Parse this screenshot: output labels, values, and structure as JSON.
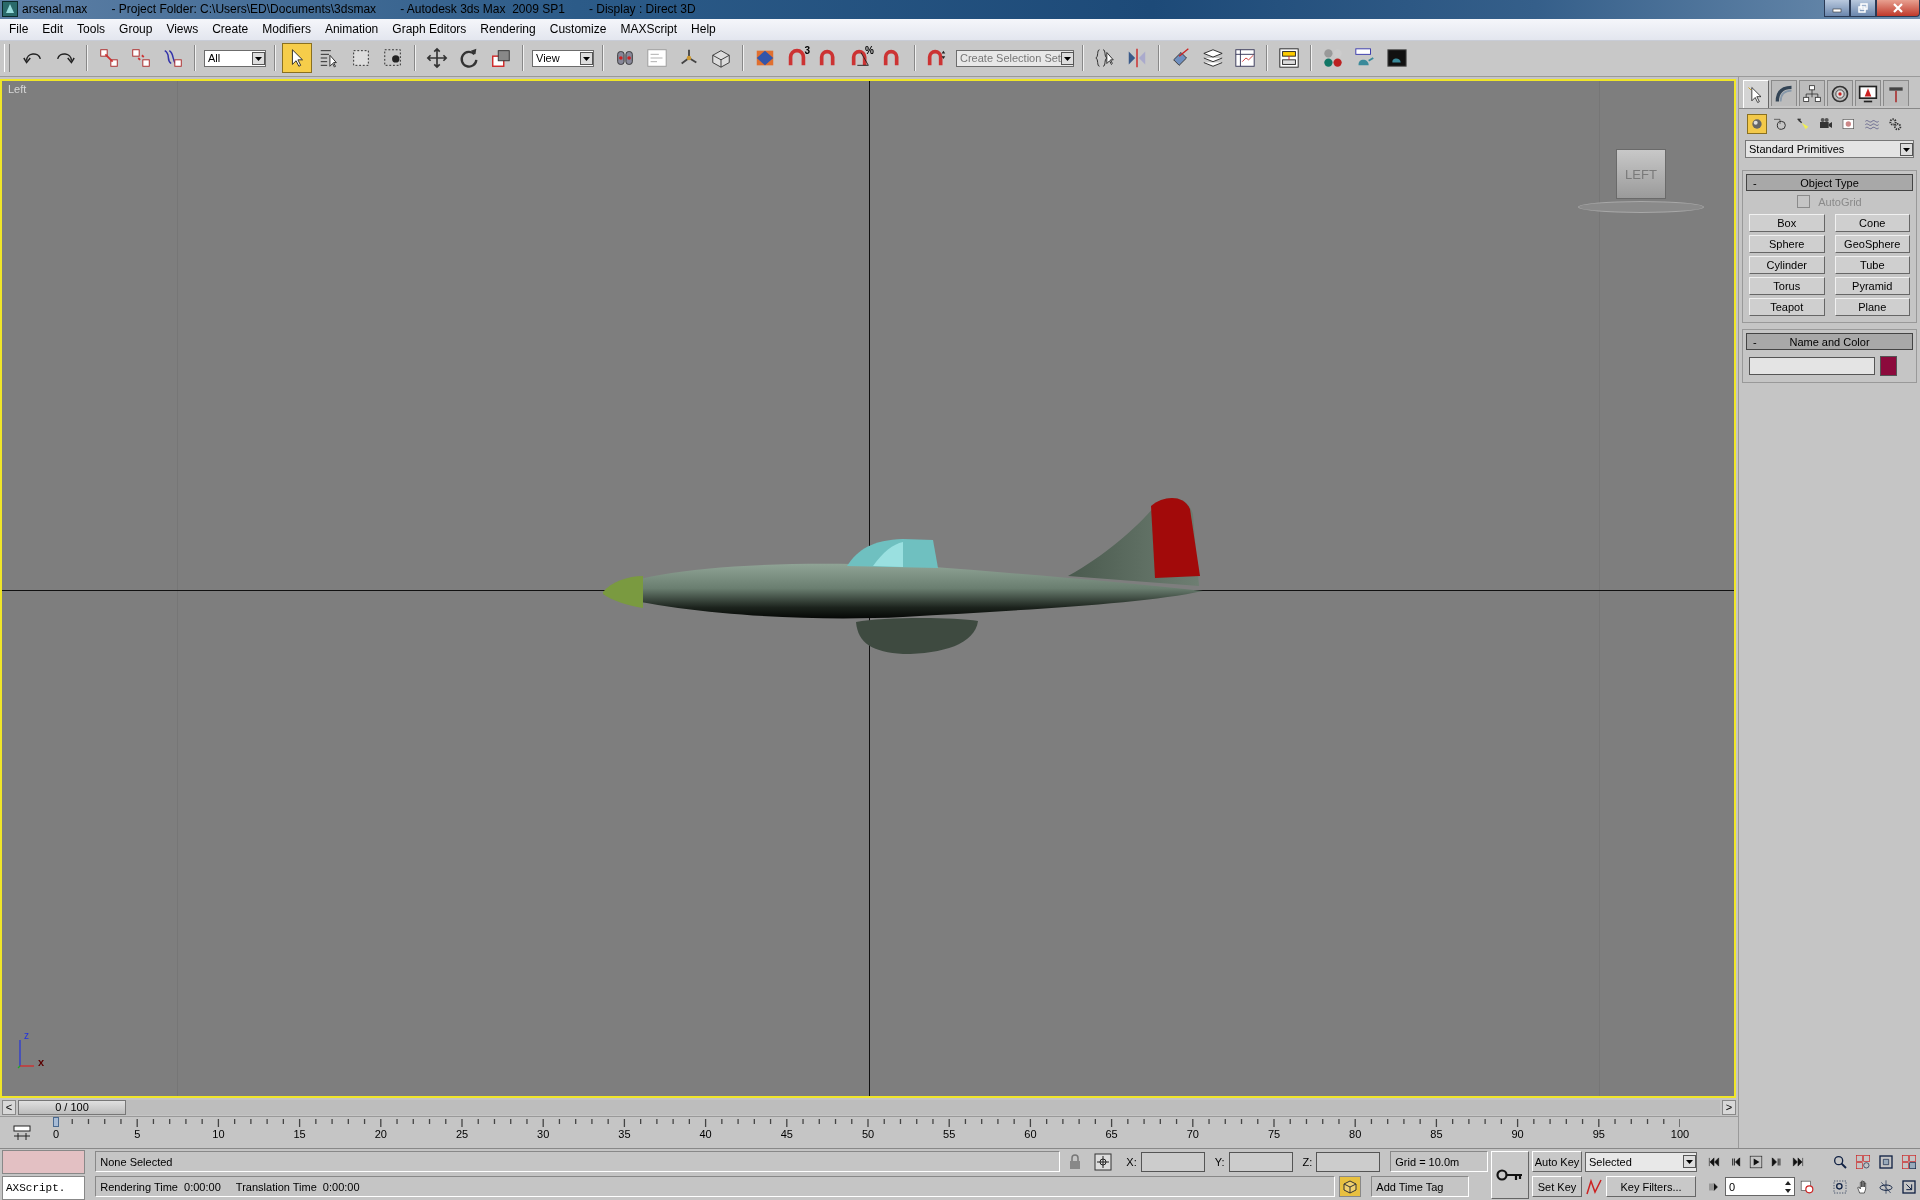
{
  "window": {
    "title_parts": [
      "arsenal.max",
      "- Project Folder: C:\\Users\\ED\\Documents\\3dsmax",
      "- Autodesk 3ds Max  2009 SP1",
      "- Display : Direct 3D"
    ]
  },
  "menu": [
    "File",
    "Edit",
    "Tools",
    "Group",
    "Views",
    "Create",
    "Modifiers",
    "Animation",
    "Graph Editors",
    "Rendering",
    "Customize",
    "MAXScript",
    "Help"
  ],
  "toolbar": {
    "items": [
      {
        "kind": "button",
        "selected": false
      },
      {
        "kind": "button",
        "selected": false
      },
      {
        "kind": "button",
        "selected": false
      },
      {
        "kind": "button",
        "selected": false
      },
      {
        "kind": "button",
        "selected": false
      },
      {
        "kind": "dropdown",
        "value": "All"
      },
      {
        "kind": "button",
        "selected": true
      },
      {
        "kind": "button",
        "selected": false
      },
      {
        "kind": "button",
        "selected": false
      },
      {
        "kind": "button",
        "selected": false
      },
      {
        "kind": "button",
        "selected": false
      },
      {
        "kind": "button",
        "selected": false
      },
      {
        "kind": "button",
        "selected": false
      },
      {
        "kind": "dropdown",
        "value": "View"
      },
      {
        "kind": "button",
        "selected": false
      },
      {
        "kind": "button",
        "selected": false
      },
      {
        "kind": "button",
        "selected": false
      },
      {
        "kind": "button",
        "selected": false
      },
      {
        "kind": "button",
        "selected": false
      },
      {
        "kind": "button",
        "selected": false,
        "badge": "3"
      },
      {
        "kind": "button",
        "selected": false
      },
      {
        "kind": "button",
        "selected": false,
        "badge": "%"
      },
      {
        "kind": "button",
        "selected": false
      },
      {
        "kind": "button",
        "selected": false
      },
      {
        "kind": "dropdown",
        "placeholder": "Create Selection Set"
      },
      {
        "kind": "button",
        "selected": false
      },
      {
        "kind": "button",
        "selected": false
      },
      {
        "kind": "button",
        "selected": false
      },
      {
        "kind": "button",
        "selected": false
      },
      {
        "kind": "button",
        "selected": false
      },
      {
        "kind": "button",
        "selected": false
      },
      {
        "kind": "button",
        "selected": false
      },
      {
        "kind": "button",
        "selected": false
      },
      {
        "kind": "button",
        "selected": false
      }
    ]
  },
  "viewport": {
    "label": "Left",
    "viewcube_label": "LEFT",
    "axis_labels": [
      "z",
      "x"
    ]
  },
  "command_panel": {
    "tabs": [
      {
        "selected": true
      },
      {
        "selected": false
      },
      {
        "selected": false
      },
      {
        "selected": false
      },
      {
        "selected": false
      },
      {
        "selected": false
      }
    ],
    "categories": [
      {
        "selected": true
      },
      {
        "selected": false
      },
      {
        "selected": false
      },
      {
        "selected": false
      },
      {
        "selected": false
      },
      {
        "selected": false
      },
      {
        "selected": false
      }
    ],
    "dropdown": "Standard Primitives",
    "object_type": {
      "collapse": "-",
      "title": "Object Type",
      "autogrid": {
        "label": "AutoGrid",
        "checked": false,
        "disabled": true
      },
      "buttons": [
        "Box",
        "Cone",
        "Sphere",
        "GeoSphere",
        "Cylinder",
        "Tube",
        "Torus",
        "Pyramid",
        "Teapot",
        "Plane"
      ]
    },
    "name_and_color": {
      "collapse": "-",
      "title": "Name and Color",
      "color": "#8c0a3c"
    }
  },
  "time_slider": {
    "label": "0 / 100",
    "level": 0,
    "prev": "<",
    "next": ">"
  },
  "timeline": {
    "labels": [
      "0",
      "5",
      "10",
      "15",
      "20",
      "25",
      "30",
      "35",
      "40",
      "45",
      "50",
      "55",
      "60",
      "65",
      "70",
      "75",
      "80",
      "85",
      "90",
      "95",
      "100"
    ]
  },
  "status": {
    "listener": "AXScript.",
    "selection": "None Selected",
    "prompt": "Rendering Time  0:00:00     Translation Time  0:00:00",
    "coords": [
      {
        "label": "X:"
      },
      {
        "label": "Y:"
      },
      {
        "label": "Z:"
      }
    ],
    "grid": "Grid = 10.0m",
    "time_tag": "Add Time Tag",
    "auto_key": "Auto Key",
    "set_key": "Set Key",
    "key_mode": "Selected",
    "key_filters": "Key Filters...",
    "frame": "0"
  }
}
